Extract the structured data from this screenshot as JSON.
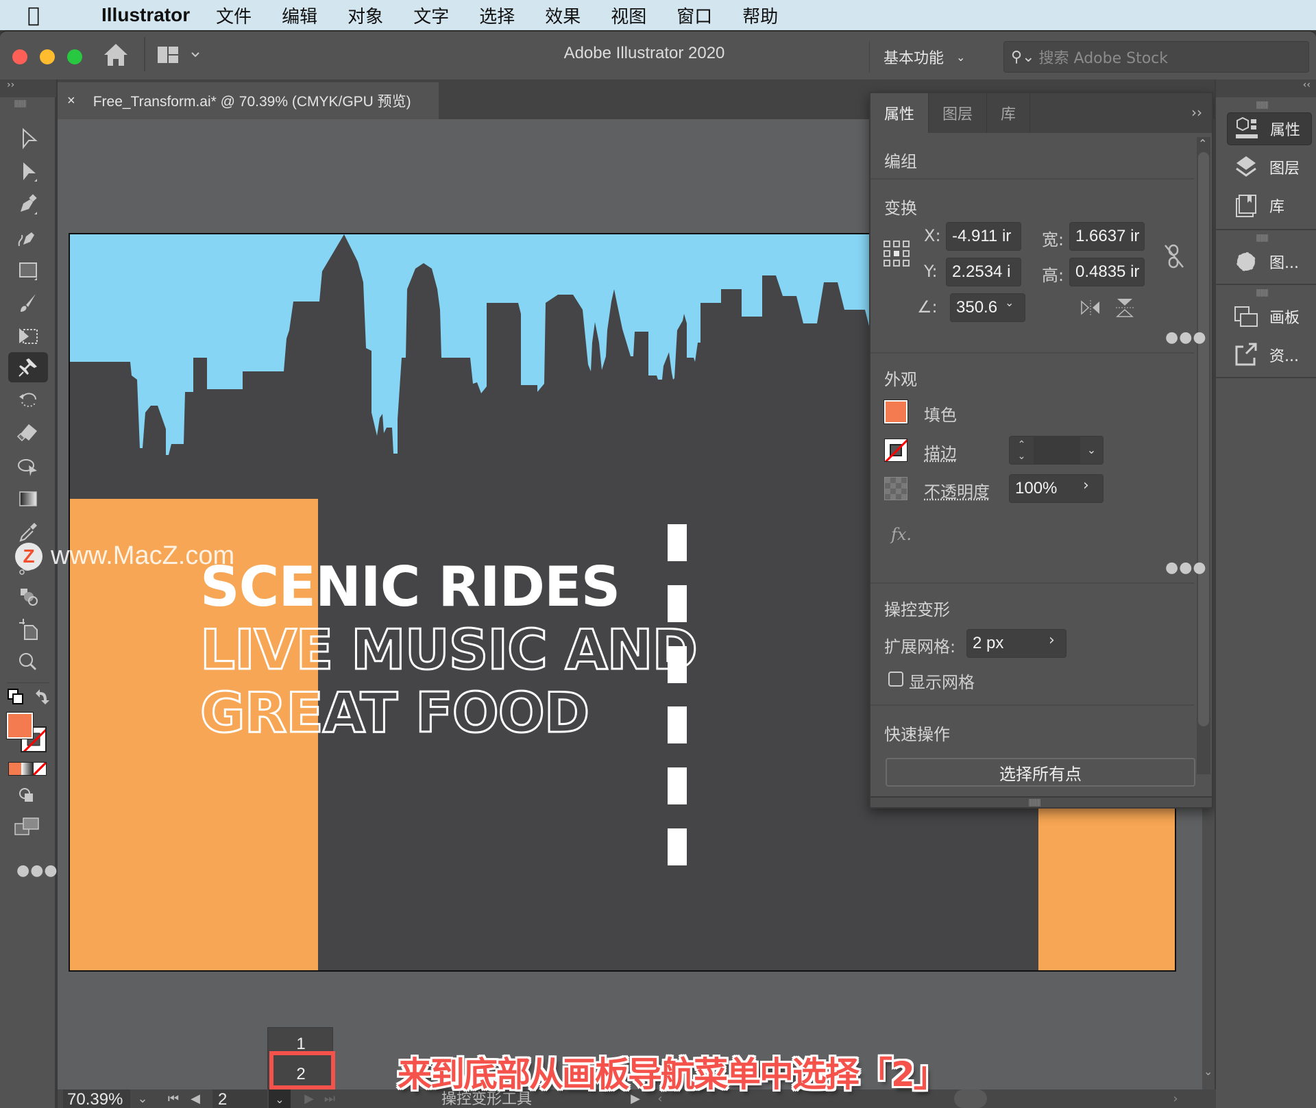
{
  "menubar": {
    "app_name": "Illustrator",
    "items": [
      "文件",
      "编辑",
      "对象",
      "文字",
      "选择",
      "效果",
      "视图",
      "窗口",
      "帮助"
    ]
  },
  "titlebar": {
    "title": "Adobe Illustrator 2020",
    "workspace": "基本功能",
    "search_placeholder": "搜索 Adobe Stock"
  },
  "document_tab": {
    "close": "×",
    "label": "Free_Transform.ai* @ 70.39% (CMYK/GPU 预览)"
  },
  "tools": [
    {
      "name": "selection-tool"
    },
    {
      "name": "direct-selection-tool"
    },
    {
      "name": "pen-tool"
    },
    {
      "name": "curvature-tool"
    },
    {
      "name": "rectangle-tool"
    },
    {
      "name": "paintbrush-tool"
    },
    {
      "name": "free-transform-tool"
    },
    {
      "name": "puppet-warp-tool",
      "active": true
    },
    {
      "name": "rotate-tool"
    },
    {
      "name": "eraser-tool"
    },
    {
      "name": "shape-builder-tool"
    },
    {
      "name": "gradient-tool"
    },
    {
      "name": "eyedropper-tool"
    },
    {
      "name": "blend-tool"
    },
    {
      "name": "symbol-sprayer-tool"
    },
    {
      "name": "artboard-tool"
    },
    {
      "name": "zoom-tool"
    }
  ],
  "colors": {
    "fill": "#f47b4f",
    "sky": "#86d5f4",
    "road": "#454547",
    "accent_orange": "#f6a654",
    "annotation_red": "#f4524a"
  },
  "artwork": {
    "line1": "SCENIC RIDES",
    "line2": "LIVE MUSIC AND",
    "line3": "GREAT FOOD"
  },
  "watermark": {
    "logo": "Z",
    "text": "www.MacZ.com"
  },
  "properties_panel": {
    "tabs": [
      "属性",
      "图层",
      "库"
    ],
    "active_tab": "属性",
    "selection_type": "编组",
    "transform": {
      "title": "变换",
      "x_label": "X:",
      "x_value": "-4.911 ir",
      "y_label": "Y:",
      "y_value": "2.2534 i",
      "w_label": "宽:",
      "w_value": "1.6637 ir",
      "h_label": "高:",
      "h_value": "0.4835 ir",
      "angle_label": "∠:",
      "angle_value": "350.6"
    },
    "appearance": {
      "title": "外观",
      "fill_label": "填色",
      "stroke_label": "描边",
      "stroke_value": "",
      "opacity_label": "不透明度",
      "opacity_value": "100%",
      "fx_label": "fx."
    },
    "puppet_warp": {
      "title": "操控变形",
      "expand_mesh_label": "扩展网格:",
      "expand_mesh_value": "2 px",
      "show_mesh_label": "显示网格",
      "show_mesh_checked": false
    },
    "quick_actions": {
      "title": "快速操作",
      "select_all_points": "选择所有点"
    }
  },
  "dock": {
    "items": [
      {
        "label": "属性",
        "icon": "properties-icon",
        "active": true
      },
      {
        "label": "图层",
        "icon": "layers-icon"
      },
      {
        "label": "库",
        "icon": "libraries-icon"
      },
      {
        "label": "图...",
        "icon": "graphic-styles-icon"
      },
      {
        "label": "画板",
        "icon": "artboards-icon"
      },
      {
        "label": "资...",
        "icon": "asset-export-icon"
      }
    ]
  },
  "statusbar": {
    "zoom": "70.39%",
    "artboard_number": "2",
    "current_tool": "操控变形工具"
  },
  "artboard_menu": {
    "options": [
      "1",
      "2"
    ],
    "highlighted": "2"
  },
  "caption": "来到底部从画板导航菜单中选择「2」"
}
